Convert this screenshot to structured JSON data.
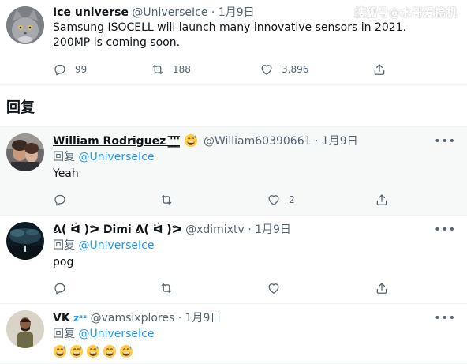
{
  "watermark": "搜狐号@水哥爱搞机",
  "main_tweet": {
    "author": "Ice universe",
    "handle": "@UniverseIce",
    "separator": "·",
    "date": "1月9日",
    "lines": [
      "Samsung ISOCELL will launch many innovative sensors in 2021.",
      "200MP is coming soon."
    ],
    "replies": "99",
    "retweets": "188",
    "likes": "3,896"
  },
  "section": {
    "title": "回复"
  },
  "replies": [
    {
      "author": "William Rodriguez '̲̅'̲̅'̲̅",
      "handle": "@William60390661",
      "separator": "·",
      "date": "1月9日",
      "reply_prefix": "回复",
      "reply_to": "@UniverseIce",
      "text": "Yeah",
      "likes": "2",
      "more": "•••"
    },
    {
      "author": "ᕕ( ᐛ )ᕗ Dimi ᕕ( ᐛ )ᕗ",
      "handle": "@xdimixtv",
      "separator": "·",
      "date": "1月9日",
      "reply_prefix": "回复",
      "reply_to": "@UniverseIce",
      "text": "pog",
      "more": "•••"
    },
    {
      "author": "VK",
      "author_suffix": "zᶻᶻ",
      "handle": "@vamsixplores",
      "separator": "·",
      "date": "1月9日",
      "reply_prefix": "回复",
      "reply_to": "@UniverseIce",
      "more": "•••"
    }
  ]
}
